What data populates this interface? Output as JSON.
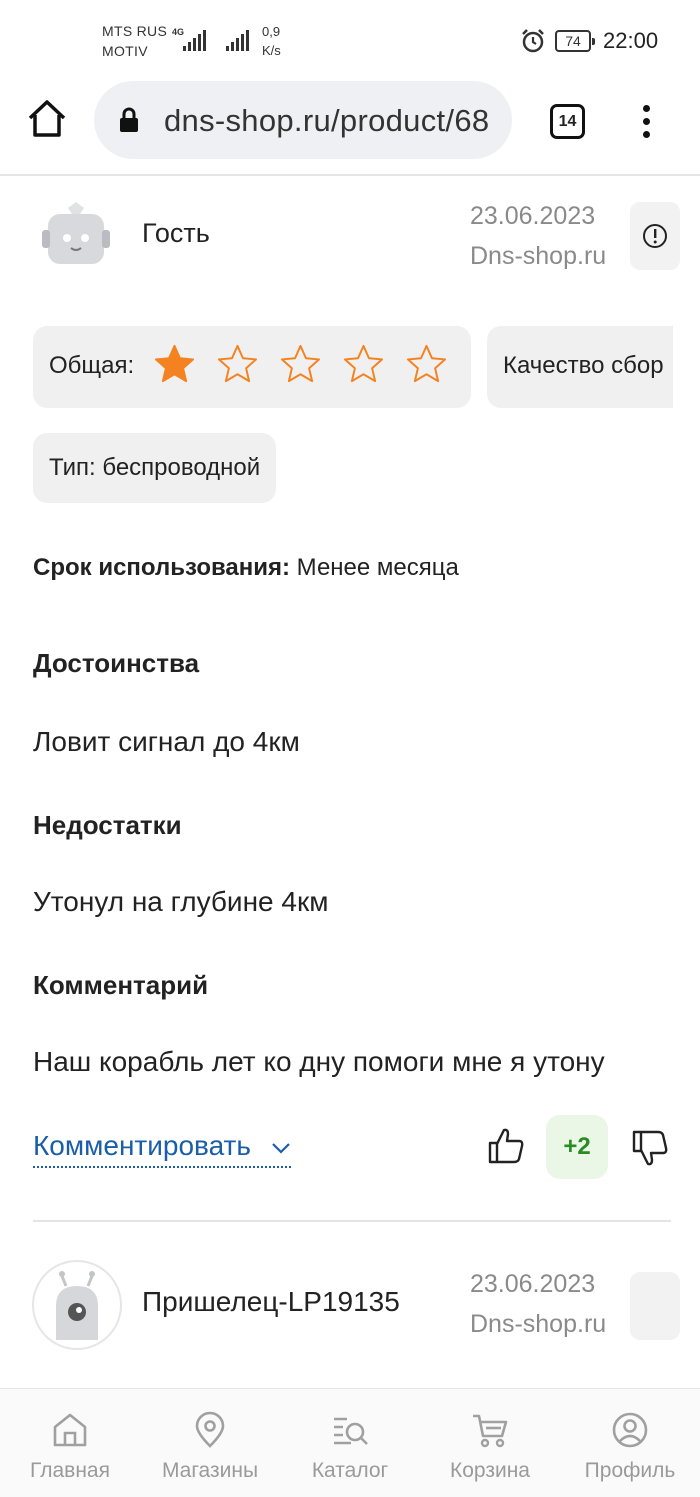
{
  "status_bar": {
    "carrier_line1": "MTS RUS",
    "carrier_line2": "MOTIV",
    "network": "4G",
    "speed_value": "0,9",
    "speed_unit": "K/s",
    "battery": "74",
    "time": "22:00"
  },
  "browser": {
    "url": "dns-shop.ru/product/68",
    "tab_count": "14"
  },
  "review1": {
    "author": "Гость",
    "date": "23.06.2023",
    "source": "Dns-shop.ru",
    "overall_label": "Общая:",
    "rating": 1,
    "rating_max": 5,
    "quality_label": "Качество сбор",
    "type_chip": "Тип: беспроводной",
    "usage_label": "Срок использования:",
    "usage_value": " Менее месяца",
    "pros_title": "Достоинства",
    "pros_text": "Ловит сигнал до 4км",
    "cons_title": "Недостатки",
    "cons_text": "Утонул на глубине 4км",
    "comment_title": "Комментарий",
    "comment_text": "Наш корабль лет ко дну помоги мне я утону",
    "comment_link": "Комментировать",
    "votes": "+2"
  },
  "review2": {
    "author": "Пришелец-LP19135",
    "date": "23.06.2023",
    "source": "Dns-shop.ru"
  },
  "bottom_nav": [
    {
      "label": "Главная",
      "icon": "home-icon"
    },
    {
      "label": "Магазины",
      "icon": "map-pin-icon"
    },
    {
      "label": "Каталог",
      "icon": "catalog-search-icon"
    },
    {
      "label": "Корзина",
      "icon": "cart-icon"
    },
    {
      "label": "Профиль",
      "icon": "profile-icon"
    }
  ],
  "colors": {
    "accent_orange": "#f58220",
    "link_blue": "#1a5ea8",
    "vote_green": "#2a8a24"
  }
}
